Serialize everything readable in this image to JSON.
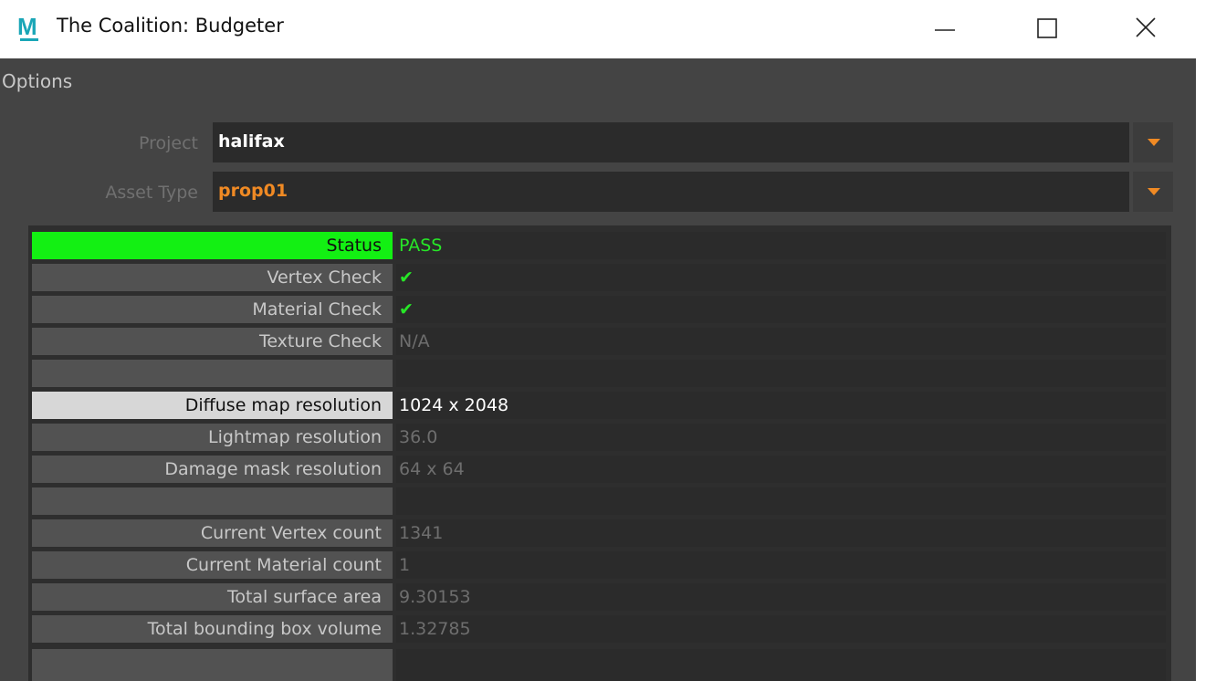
{
  "window": {
    "icon_letter": "M",
    "title": "The Coalition: Budgeter",
    "minimize_icon": "minimize-icon",
    "maximize_icon": "maximize-icon",
    "close_icon": "close-icon"
  },
  "menu": {
    "options_label": "Options"
  },
  "fields": {
    "project": {
      "label": "Project",
      "value": "halifax",
      "value_color": "#ffffff"
    },
    "asset_type": {
      "label": "Asset Type",
      "value": "prop01",
      "value_color": "#f08a24"
    }
  },
  "results": {
    "rows": [
      {
        "label": "Status",
        "value": "PASS"
      },
      {
        "label": "Vertex Check",
        "value": "✔"
      },
      {
        "label": "Material Check",
        "value": "✔"
      },
      {
        "label": "Texture Check",
        "value": "N/A"
      },
      {
        "label": "",
        "value": ""
      },
      {
        "label": "Diffuse map resolution",
        "value": "1024 x 2048"
      },
      {
        "label": "Lightmap resolution",
        "value": "36.0"
      },
      {
        "label": "Damage mask resolution",
        "value": "64 x 64"
      },
      {
        "label": "",
        "value": ""
      },
      {
        "label": "Current Vertex count",
        "value": "1341"
      },
      {
        "label": "Current Material count",
        "value": "1"
      },
      {
        "label": "Total surface area",
        "value": "9.30153"
      },
      {
        "label": "Total bounding box volume",
        "value": "1.32785"
      }
    ]
  },
  "colors": {
    "accent": "#f08a24",
    "pass_green": "#13f013",
    "background": "#444444"
  }
}
